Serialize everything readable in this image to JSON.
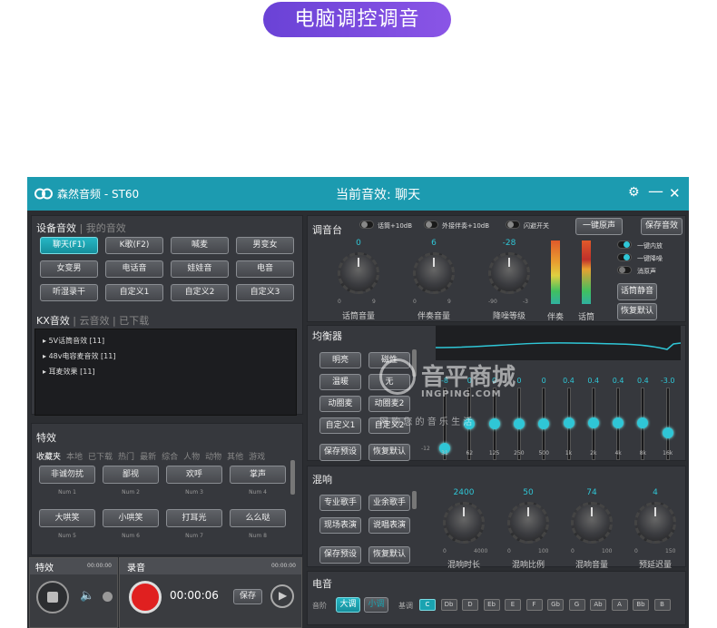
{
  "banner": {
    "title": "电脑调控调音"
  },
  "titlebar": {
    "app_name": "森然音频 - ST60",
    "current_effect": "当前音效: 聊天"
  },
  "device_fx": {
    "header": "设备音效",
    "header_dim": " | 我的音效",
    "buttons": [
      "聊天(F1)",
      "K歌(F2)",
      "喊麦",
      "男变女",
      "女变男",
      "电话音",
      "娃娃音",
      "电音",
      "听湿录干",
      "自定义1",
      "自定义2",
      "自定义3"
    ],
    "active": "聊天(F1)"
  },
  "kx_fx": {
    "header": "KX音效",
    "header_dim": " | 云音效 | 已下载",
    "items": [
      "5V话筒音效 [11]",
      "48v电容麦音效 [11]",
      "耳麦效果 [11]"
    ]
  },
  "special_fx": {
    "header": "特效",
    "tabs": [
      "收藏夹",
      "本地",
      "已下载",
      "热门",
      "最新",
      "综合",
      "人物",
      "动物",
      "其他",
      "游戏"
    ],
    "active_tab": "收藏夹",
    "buttons": [
      {
        "label": "非诚勿扰",
        "num": "Num 1"
      },
      {
        "label": "鄙视",
        "num": "Num 2"
      },
      {
        "label": "欢呼",
        "num": "Num 3"
      },
      {
        "label": "掌声",
        "num": "Num 4"
      },
      {
        "label": "大哄笑",
        "num": "Num 5"
      },
      {
        "label": "小哄笑",
        "num": "Num 6"
      },
      {
        "label": "打耳光",
        "num": "Num 7"
      },
      {
        "label": "么么哒",
        "num": "Num 8"
      }
    ]
  },
  "bottom": {
    "fx_label": "特效",
    "fx_time": "00:00:00",
    "rec_label": "录音",
    "rec_time_top": "00:00:00",
    "rec_time": "00:00:06",
    "save": "保存"
  },
  "mixer": {
    "title": "调音台",
    "toggles": [
      "话筒+10dB",
      "外接伴奏+10dB",
      "闪避开关"
    ],
    "one_key": "一键原声",
    "save_fx": "保存音效",
    "knobs": [
      {
        "value": "0",
        "label": "话筒音量",
        "min": "0",
        "max": "9"
      },
      {
        "value": "6",
        "label": "伴奏音量",
        "min": "0",
        "max": "9"
      },
      {
        "value": "-28",
        "label": "降噪等级",
        "min": "-90",
        "max": "-3"
      }
    ],
    "meters": [
      "伴奏",
      "话筒"
    ],
    "switches": [
      "一键内放",
      "一键降噪",
      "消原声"
    ],
    "mic_mute": "话筒静音",
    "restore": "恢复默认"
  },
  "eq": {
    "title": "均衡器",
    "presets": [
      "明亮",
      "磁性",
      "温暖",
      "无",
      "动圈麦",
      "动圈麦2",
      "自定义1",
      "自定义2"
    ],
    "save": "保存预设",
    "restore": "恢复默认",
    "freqs": [
      "31",
      "62",
      "125",
      "250",
      "500",
      "1k",
      "2k",
      "4k",
      "8k",
      "16k"
    ],
    "values": [
      "-8",
      "0",
      "0",
      "0",
      "0",
      "0.4",
      "0.4",
      "0.4",
      "0.4",
      "-3.0"
    ],
    "scale_low": "-12"
  },
  "reverb": {
    "title": "混响",
    "presets": [
      "专业歌手",
      "业余歌手",
      "现场表演",
      "说唱表演"
    ],
    "save": "保存预设",
    "restore": "恢复默认",
    "knobs": [
      {
        "value": "2400",
        "label": "混响时长",
        "min": "0",
        "max": "4000"
      },
      {
        "value": "50",
        "label": "混响比例",
        "min": "0",
        "max": "100"
      },
      {
        "value": "74",
        "label": "混响音量",
        "min": "0",
        "max": "100"
      },
      {
        "value": "4",
        "label": "预延迟量",
        "min": "0",
        "max": "150"
      }
    ]
  },
  "electro": {
    "title": "电音",
    "scale_label": "音阶",
    "scales": [
      "大调",
      "小调"
    ],
    "key_label": "基调",
    "keys": [
      "C",
      "Db",
      "D",
      "Eb",
      "E",
      "F",
      "Gb",
      "G",
      "Ab",
      "A",
      "Bb",
      "B"
    ]
  },
  "watermark": {
    "cn": "音平商城",
    "en": "INGPING.COM",
    "sub": "网 购 您 的 音 乐 生 活"
  },
  "colors": {
    "accent": "#1c9bb0",
    "highlight": "#2fc6d6",
    "banner": "#7a4be0"
  }
}
